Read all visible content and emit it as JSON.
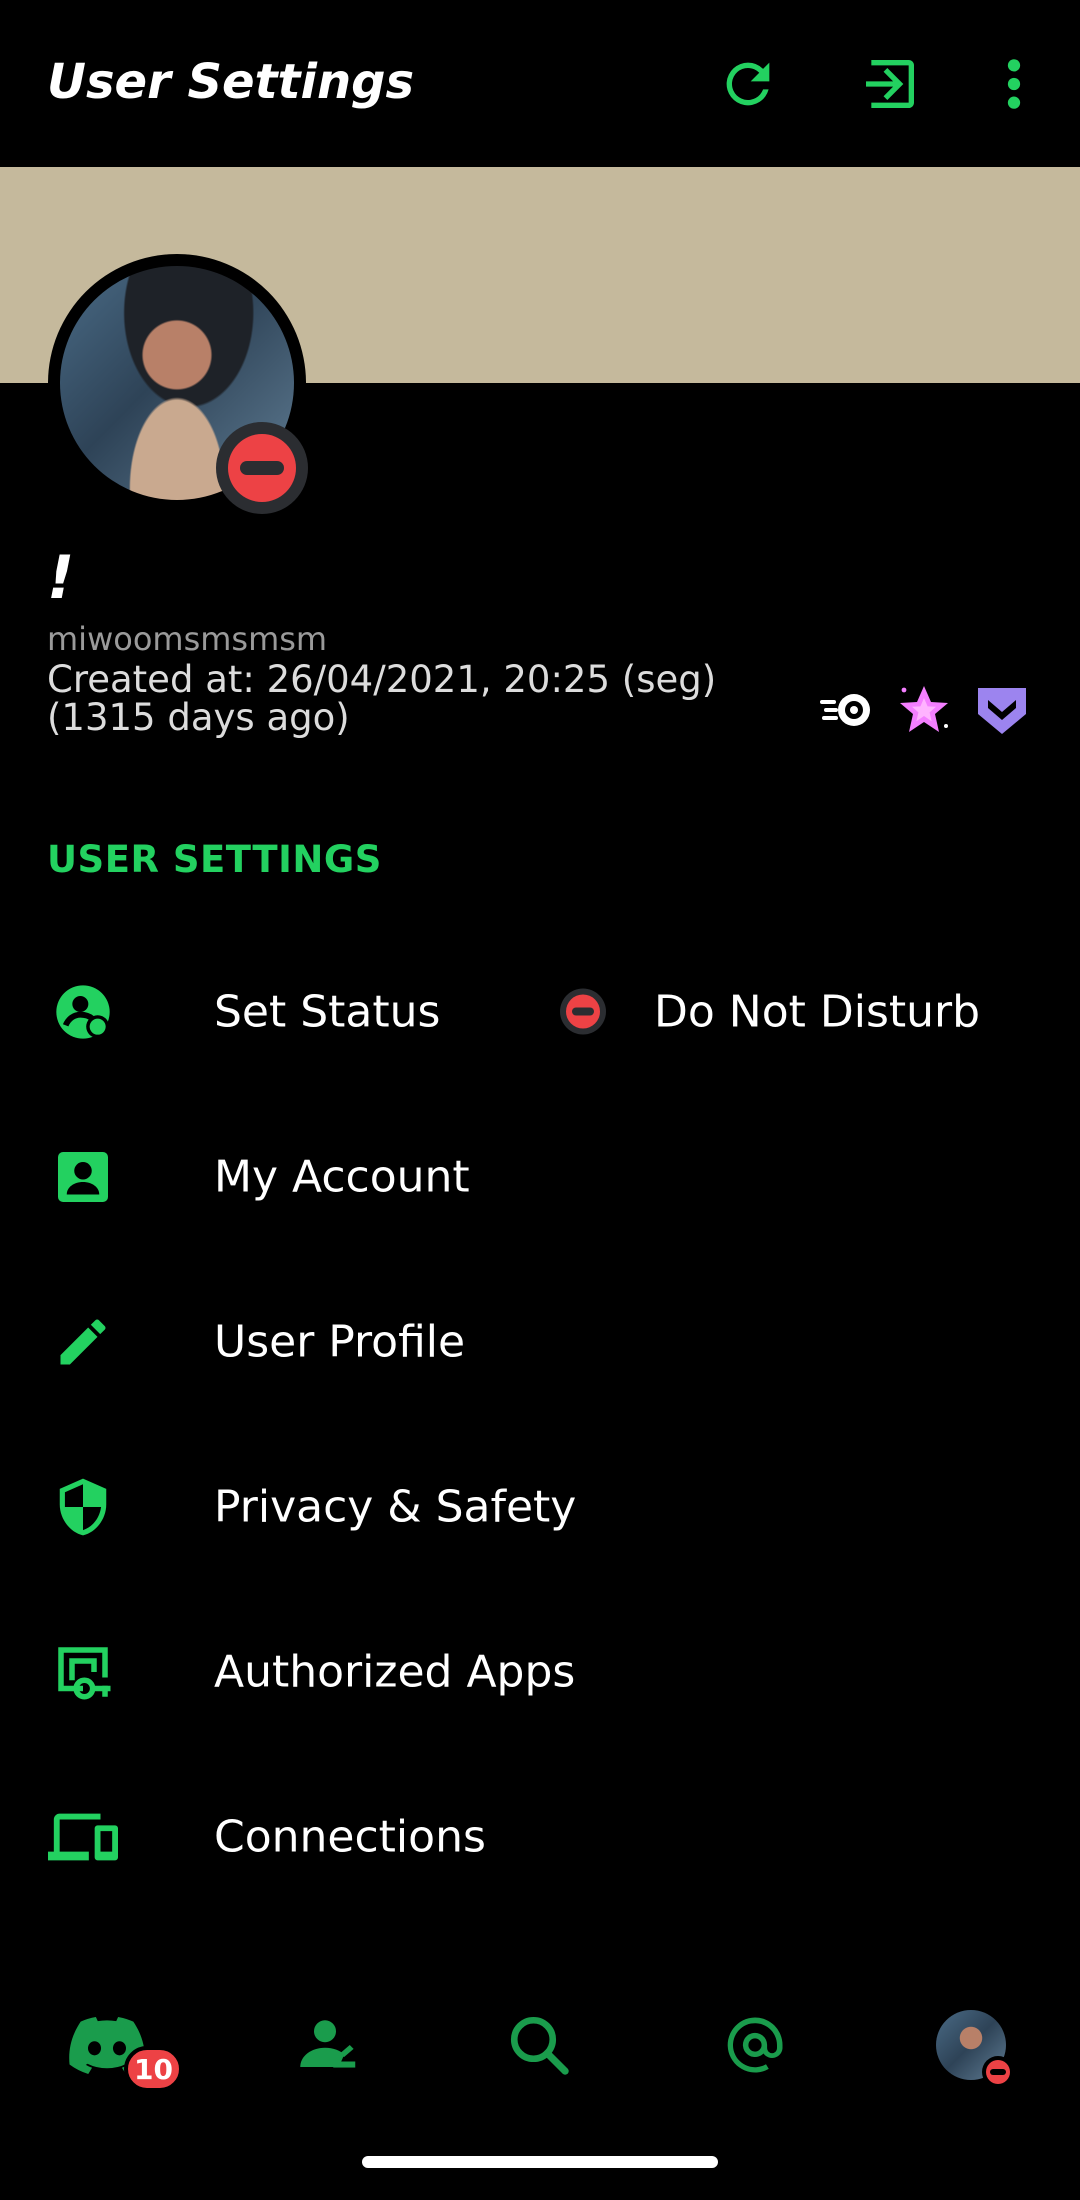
{
  "header": {
    "title": "User Settings",
    "icons": [
      "refresh-icon",
      "logout-icon",
      "more-vert-icon"
    ]
  },
  "profile": {
    "display_name": "!",
    "username": "miwoomsmsmsm",
    "created": "Created at: 26/04/2021, 20:25 (seg) (1315 days ago)",
    "status": "dnd",
    "badges": [
      "speed-badge-icon",
      "nitro-star-badge-icon",
      "hypesquad-badge-icon"
    ]
  },
  "section": {
    "title": "USER SETTINGS"
  },
  "menu": {
    "items": [
      {
        "label": "Set Status",
        "icon": "status-icon",
        "value": "Do Not Disturb"
      },
      {
        "label": "My Account",
        "icon": "account-icon"
      },
      {
        "label": "User Profile",
        "icon": "pencil-icon"
      },
      {
        "label": "Privacy & Safety",
        "icon": "shield-icon"
      },
      {
        "label": "Authorized Apps",
        "icon": "authorized-apps-icon"
      },
      {
        "label": "Connections",
        "icon": "devices-icon"
      }
    ]
  },
  "nav": {
    "home_badge": "10",
    "items": [
      "home-icon",
      "friends-icon",
      "search-icon",
      "mentions-icon",
      "profile-avatar"
    ]
  },
  "colors": {
    "accent": "#23d160",
    "banner": "#c5b99c",
    "dnd": "#ed4245",
    "background": "#000000"
  }
}
